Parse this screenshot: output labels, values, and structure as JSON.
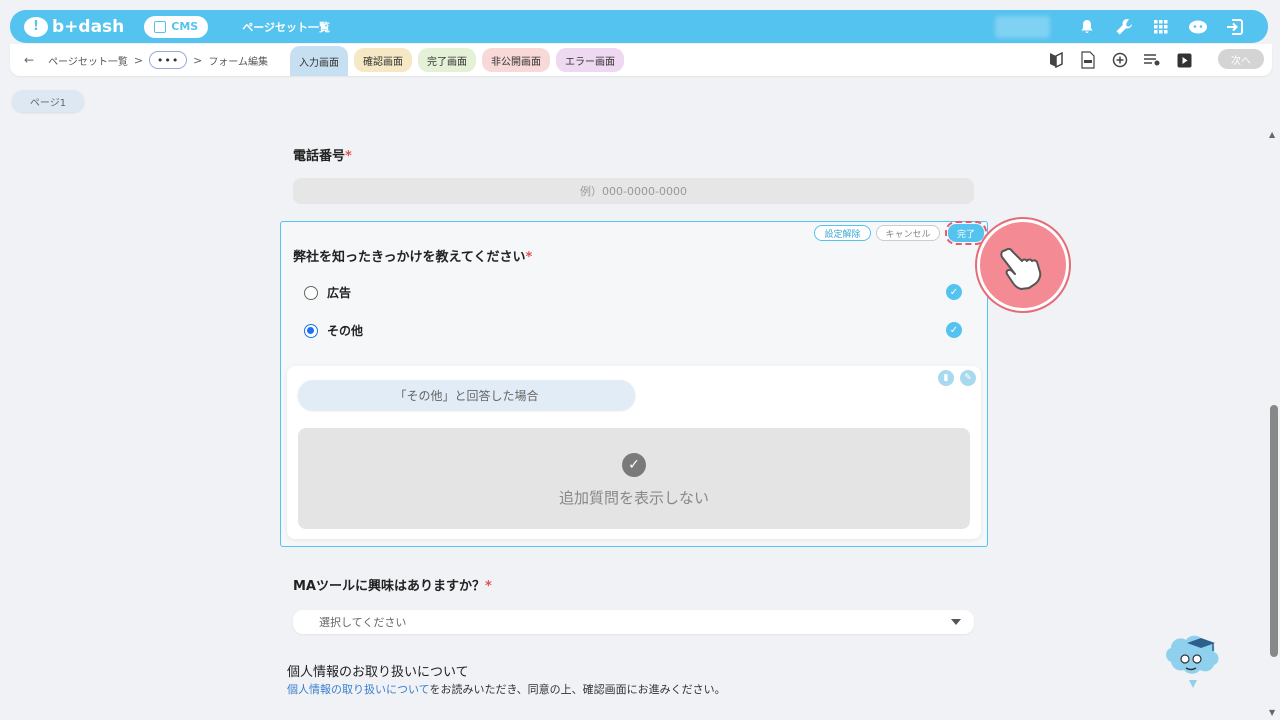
{
  "header": {
    "logo_text": "b+dash",
    "cms_label": "CMS",
    "title": "ページセット一覧",
    "icons": [
      "bell-icon",
      "wrench-icon",
      "grid-icon",
      "assistant-icon",
      "logout-icon"
    ]
  },
  "subbar": {
    "back_icon": "←",
    "breadcrumb": [
      "ページセット一覧",
      "フォーム編集"
    ],
    "separator": ">",
    "more": "•••",
    "tabs": [
      {
        "label": "入力画面",
        "active": true
      },
      {
        "label": "確認画面"
      },
      {
        "label": "完了画面"
      },
      {
        "label": "非公開画面"
      },
      {
        "label": "エラー画面"
      }
    ],
    "tool_icons": [
      "beginner-icon",
      "html-file-icon",
      "add-circle-icon",
      "list-settings-icon",
      "play-icon"
    ],
    "next_label": "次へ"
  },
  "page_tab": "ページ1",
  "form": {
    "phone": {
      "label": "電話番号",
      "required_mark": "*",
      "placeholder": "例）000-0000-0000"
    },
    "source_question": {
      "label": "弊社を知ったきっかけを教えてください",
      "required_mark": "*",
      "actions": {
        "unset": "設定解除",
        "cancel": "キャンセル",
        "done": "完了"
      },
      "options": [
        {
          "label": "広告",
          "selected": false
        },
        {
          "label": "その他",
          "selected": true
        }
      ],
      "condition_label": "「その他」と回答した場合",
      "no_followup_label": "追加質問を表示しない"
    },
    "ma_tool": {
      "label": "MAツールに興味はありますか？",
      "required_mark": "*",
      "placeholder": "選択してください"
    },
    "privacy": {
      "title": "個人情報のお取り扱いについて",
      "link_text": "個人情報の取り扱いについて",
      "text": "をお読みいただき、同意の上、確認画面にお進みください。"
    }
  },
  "colors": {
    "accent": "#55c3ef",
    "required": "#e05252",
    "highlight": "#f48b94"
  }
}
